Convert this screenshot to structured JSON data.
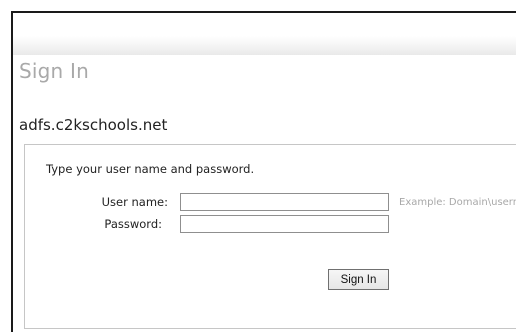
{
  "page": {
    "title": "Sign In",
    "domain": "adfs.c2kschools.net"
  },
  "form": {
    "instructions": "Type your user name and password.",
    "username_label": "User name:",
    "username_value": "",
    "username_hint": "Example: Domain\\username",
    "password_label": "Password:",
    "password_value": "",
    "submit_label": "Sign In"
  }
}
